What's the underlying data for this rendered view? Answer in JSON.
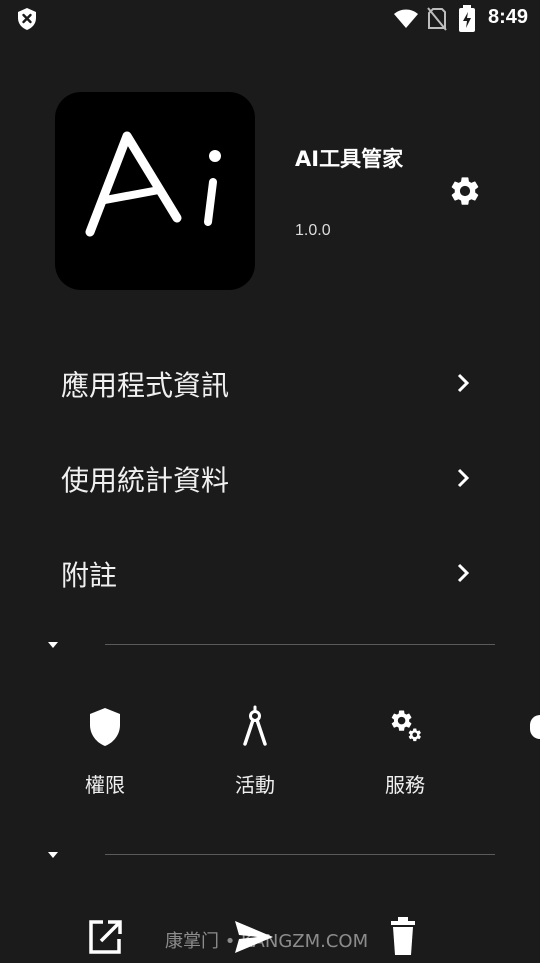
{
  "status_bar": {
    "time": "8:49",
    "icons": [
      "shield-close-icon",
      "wifi-icon",
      "no-sim-icon",
      "battery-charging-icon"
    ]
  },
  "app": {
    "icon_text": "Ai",
    "name": "AI工具管家",
    "version": "1.0.0"
  },
  "menu": [
    {
      "label": "應用程式資訊"
    },
    {
      "label": "使用統計資料"
    },
    {
      "label": "附註"
    }
  ],
  "components": [
    {
      "label": "權限",
      "icon": "shield-icon"
    },
    {
      "label": "活動",
      "icon": "compass-icon"
    },
    {
      "label": "服務",
      "icon": "gears-icon"
    }
  ],
  "watermark": "康掌门 • KANGZM.COM",
  "bottom_actions": [
    "open-external-icon",
    "send-icon",
    "delete-icon"
  ]
}
